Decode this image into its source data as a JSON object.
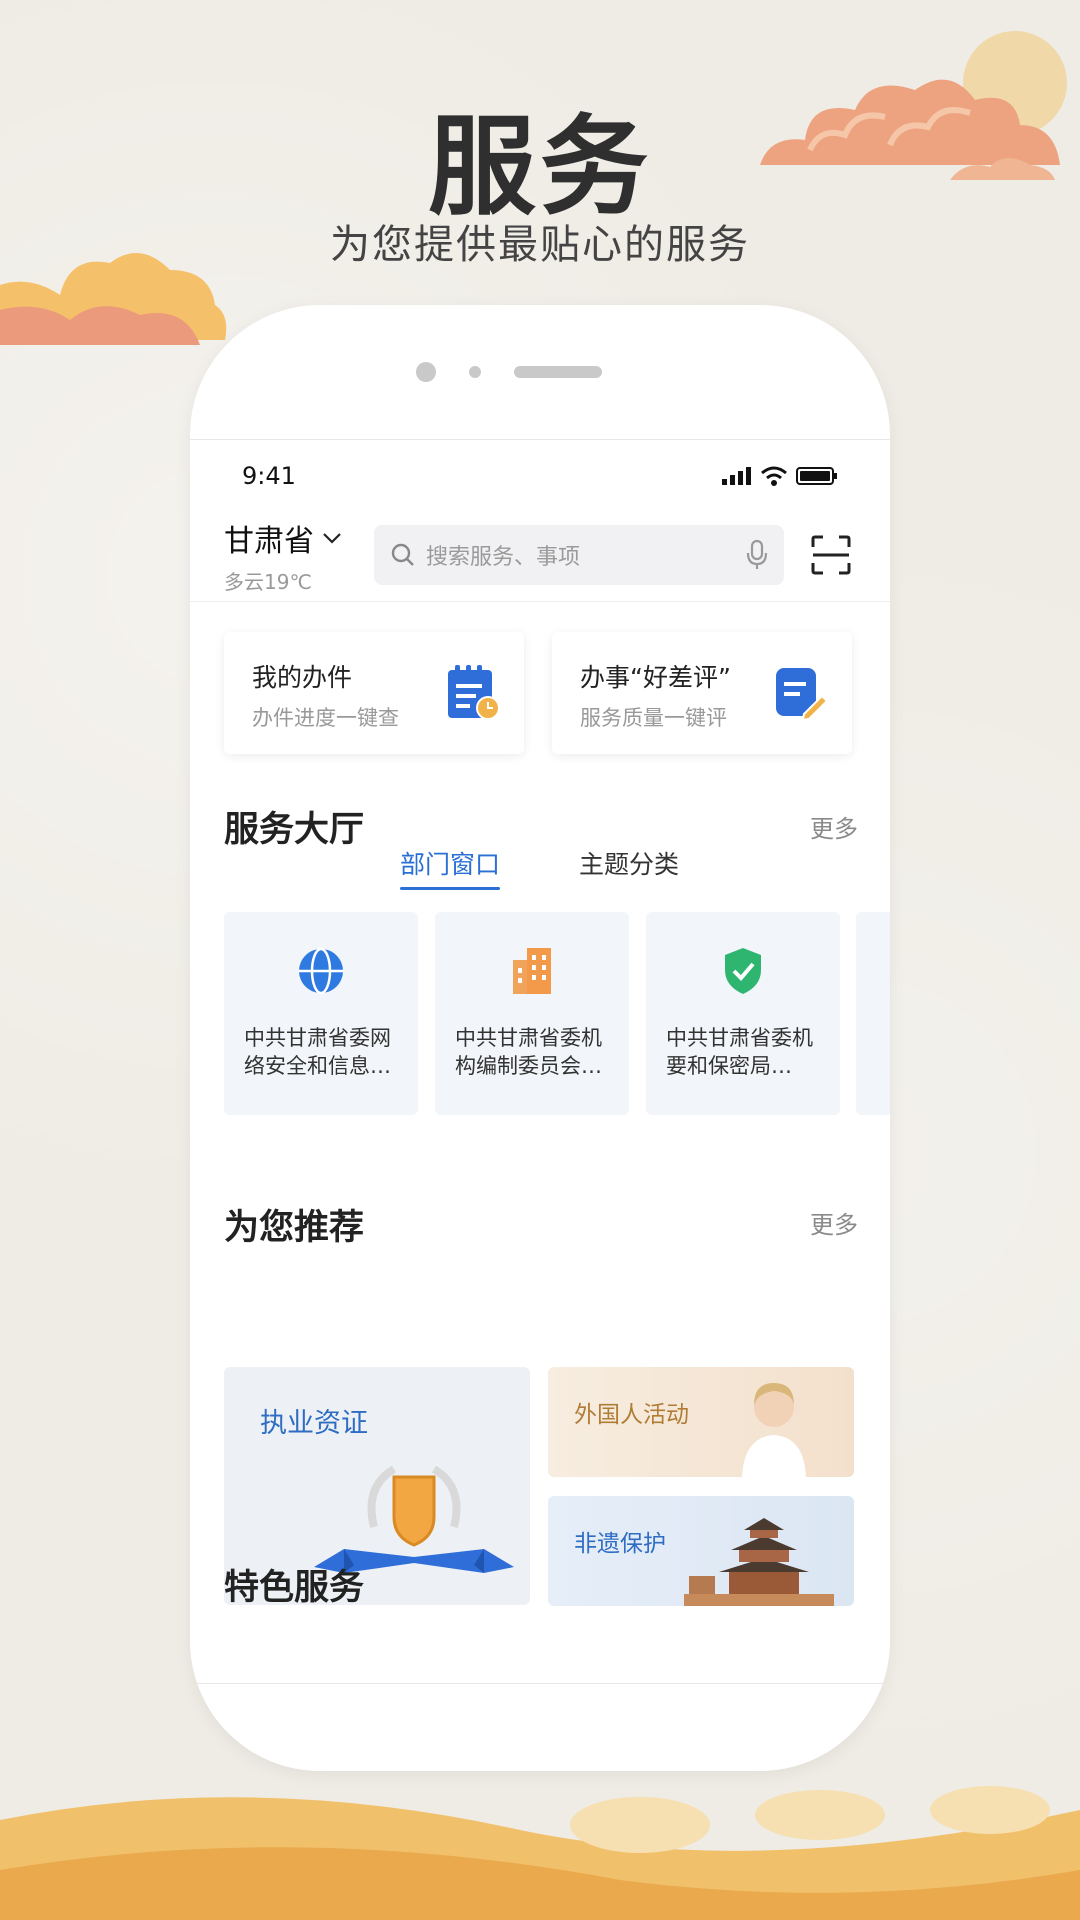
{
  "hero": {
    "title": "服务",
    "subtitle": "为您提供最贴心的服务"
  },
  "status_bar": {
    "time": "9:41"
  },
  "location": {
    "name": "甘肃省",
    "weather": "多云19℃"
  },
  "search": {
    "placeholder": "搜索服务、事项"
  },
  "quick_cards": [
    {
      "title": "我的办件",
      "subtitle": "办件进度一键查",
      "icon": "clipboard-clock-icon"
    },
    {
      "title": "办事“好差评”",
      "subtitle": "服务质量一键评",
      "icon": "note-edit-icon"
    }
  ],
  "service_hall": {
    "title": "服务大厅",
    "more": "更多",
    "tabs": [
      {
        "label": "部门窗口"
      },
      {
        "label": "主题分类"
      }
    ],
    "active_tab": "部门窗口",
    "departments": [
      {
        "line1": "中共甘肃省委网",
        "line2": "络安全和信息…",
        "icon": "globe-icon"
      },
      {
        "line1": "中共甘肃省委机",
        "line2": "构编制委员会…",
        "icon": "building-icon"
      },
      {
        "line1": "中共甘肃省委机",
        "line2": "要和保密局…",
        "icon": "shield-check-icon"
      }
    ]
  },
  "recommend": {
    "title": "为您推荐",
    "more": "更多",
    "items": [
      {
        "title": "执业资证"
      },
      {
        "title": "外国人活动"
      },
      {
        "title": "非遗保护"
      }
    ]
  },
  "featured": {
    "title": "特色服务"
  },
  "colors": {
    "accent": "#2a6fd6",
    "background": "#efece5",
    "gold": "#b07d36"
  }
}
